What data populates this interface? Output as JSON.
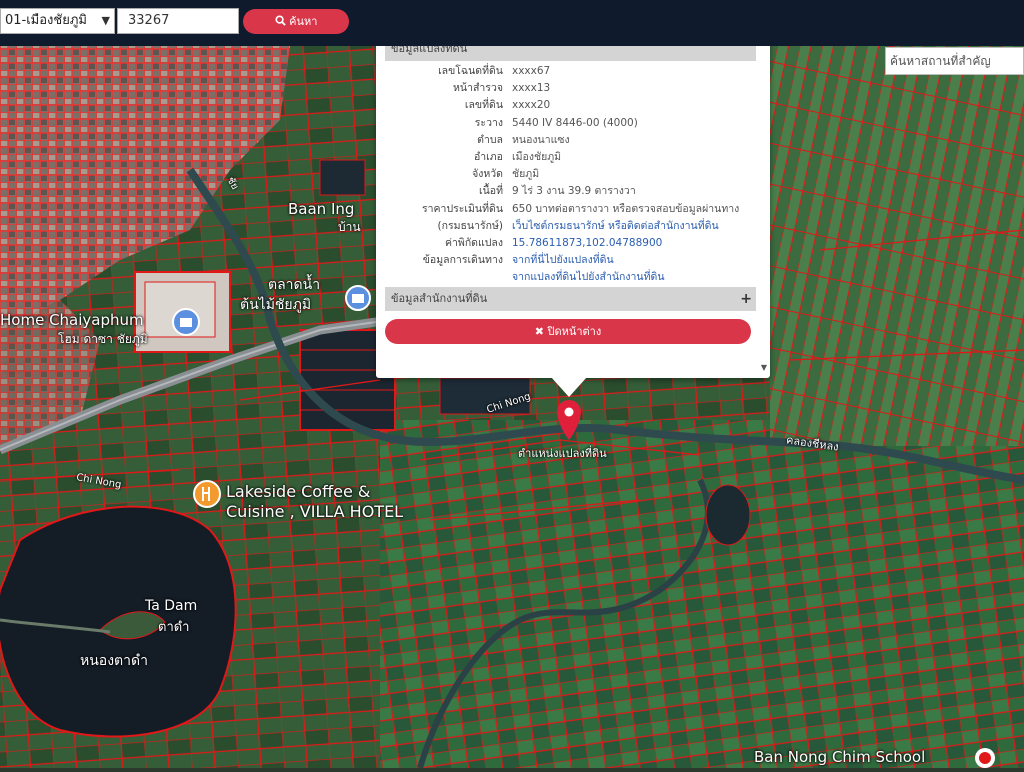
{
  "toolbar": {
    "district_select": "01-เมืองชัยภูมิ",
    "parcel_number_value": "33267",
    "search_button": "ค้นหา"
  },
  "place_search": {
    "placeholder": "ค้นหาสถานที่สำคัญ"
  },
  "popup": {
    "section1_title": "ข้อมูลแปลงที่ดิน",
    "rows": [
      {
        "label": "เลขโฉนดที่ดิน",
        "value": "xxxx67"
      },
      {
        "label": "หน้าสำรวจ",
        "value": "xxxx13"
      },
      {
        "label": "เลขที่ดิน",
        "value": "xxxx20"
      },
      {
        "label": "ระวาง",
        "value": "5440 IV 8446-00 (4000)"
      },
      {
        "label": "ตำบล",
        "value": "หนองนาแซง"
      },
      {
        "label": "อำเภอ",
        "value": "เมืองชัยภูมิ"
      },
      {
        "label": "จังหวัด",
        "value": "ชัยภูมิ"
      },
      {
        "label": "เนื้อที่",
        "value": "9 ไร่ 3 งาน 39.9 ตารางวา"
      },
      {
        "label": "ราคาประเมินที่ดิน",
        "value": "650 บาทต่อตารางวา หรือตรวจสอบข้อมูลผ่านทาง"
      },
      {
        "label": "(กรมธนารักษ์)",
        "value": "เว็บไซต์กรมธนารักษ์ หรือติดต่อสำนักงานที่ดิน"
      },
      {
        "label": "ค่าพิกัดแปลง",
        "value": "15.78611873,102.04788900"
      },
      {
        "label": "ข้อมูลการเดินทาง",
        "value": "จากที่นี่ไปยังแปลงที่ดิน"
      },
      {
        "label": "",
        "value": "จากแปลงที่ดินไปยังสำนักงานที่ดิน"
      }
    ],
    "section2_title": "ข้อมูลสำนักงานที่ดิน",
    "close_button": "ปิดหน้าต่าง"
  },
  "map_labels": {
    "baan_ing": "Baan Ing",
    "baan_ing_th": "บ้าน",
    "home_chaiyaphum": "Home Chaiyaphum",
    "home_chaiyaphum_th": "โฮม ดาซา ชัยภูมิ",
    "market": "ตลาดน้ำ",
    "market2": "ต้นไม้ชัยภูมิ",
    "road_chi_nong": "Chi Nong",
    "road_chi_nong2": "Chi Nong",
    "lakeside1": "Lakeside Coffee &",
    "lakeside2": "Cuisine , VILLA HOTEL",
    "ta_dam": "Ta Dam",
    "ta_dam_th": "ตาดำ",
    "nong_ta_dam": "หนองตาดำ",
    "parcel_marker": "ตำแหน่งแปลงที่ดิน",
    "canal": "คลองชีหลง",
    "school": "Ban Nong Chim School",
    "road_bypass": "ชัย"
  },
  "colors": {
    "topbar": "#0f1b2d",
    "accent_red": "#d9364a",
    "parcel_lines": "#e01818",
    "link_blue": "#2a5db0"
  },
  "icons": {
    "search": "search-icon",
    "close": "close-icon",
    "marker": "map-pin-icon",
    "shop": "shopping-bag-icon",
    "food": "restaurant-icon"
  }
}
